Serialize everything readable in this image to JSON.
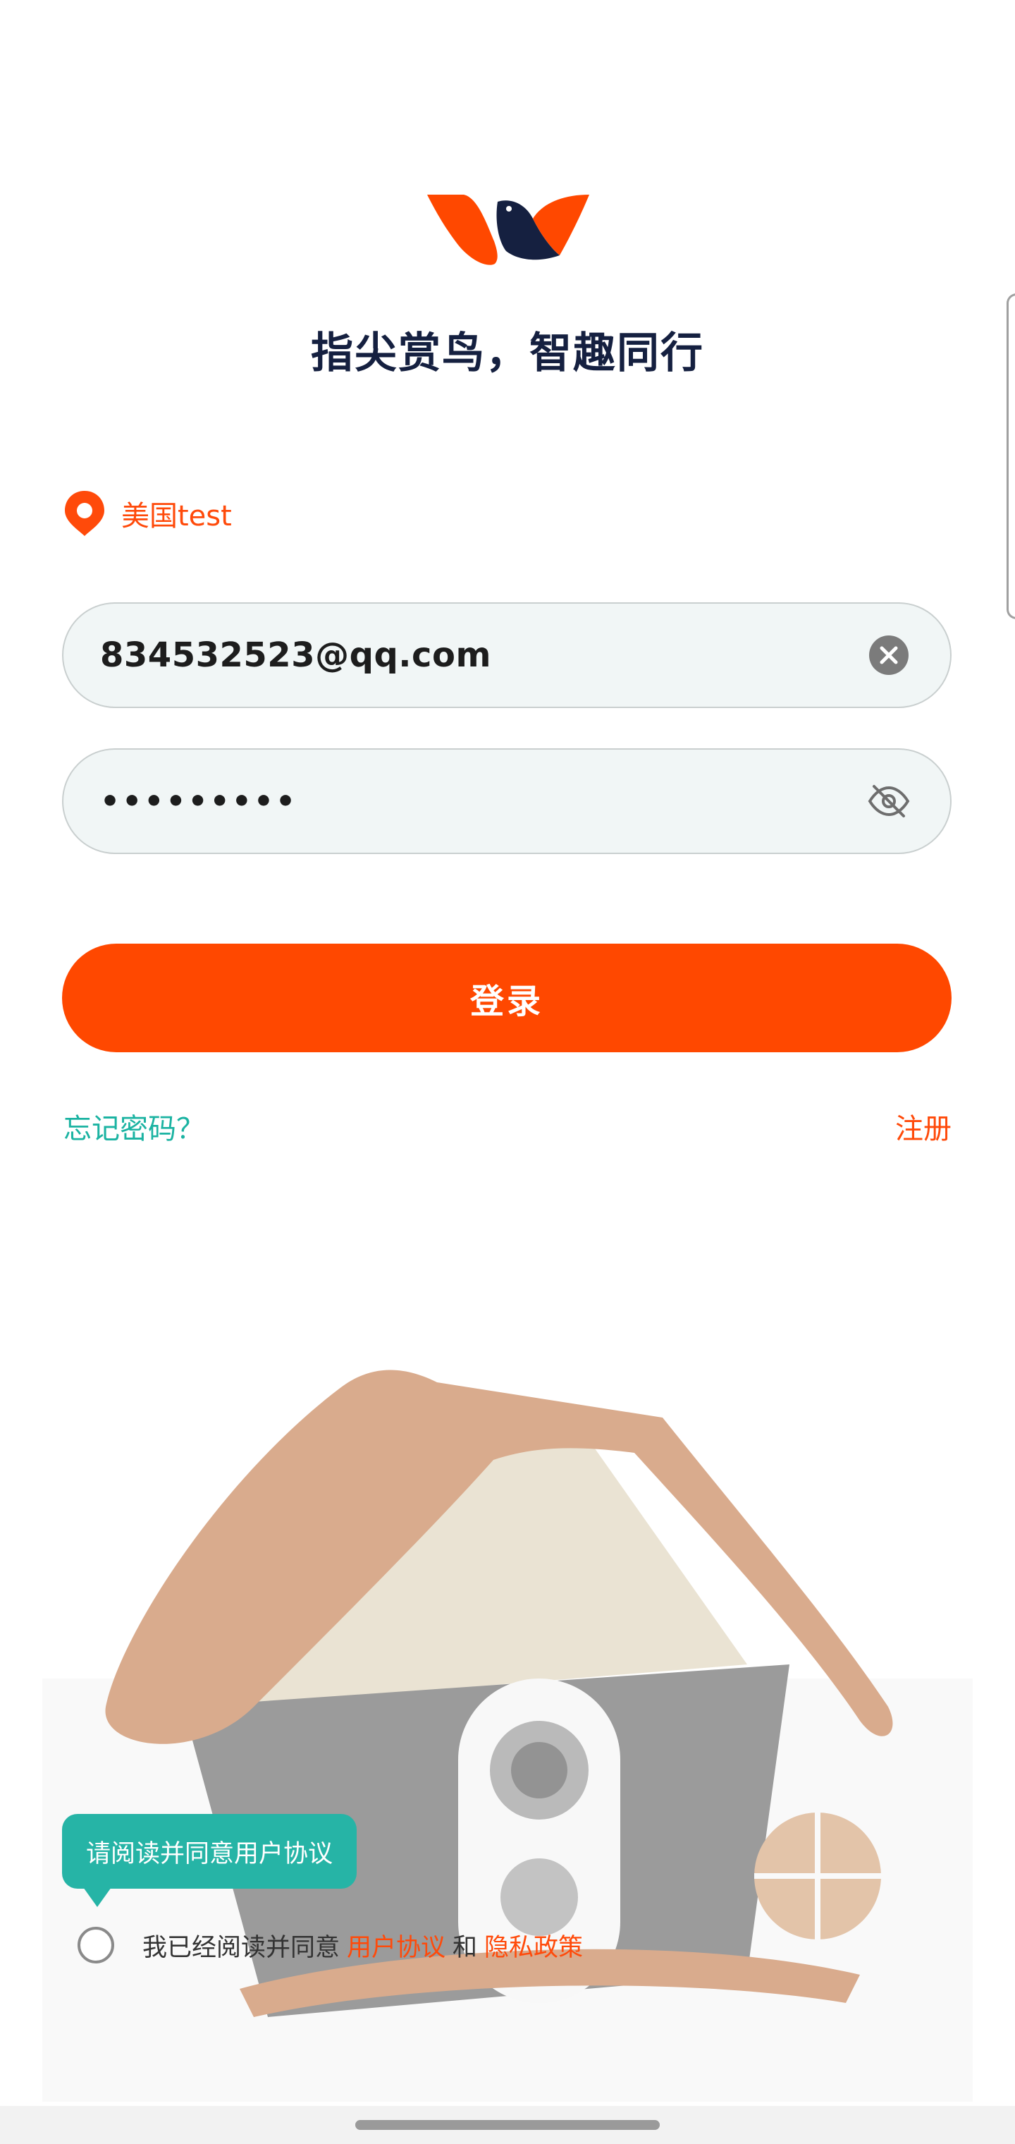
{
  "header": {
    "slogan": "指尖赏鸟，智趣同行"
  },
  "region": {
    "label": "美国test",
    "icon": "location-pin-icon"
  },
  "form": {
    "email_value": "834532523@qq.com",
    "password_value": "•••••••••",
    "clear_icon": "clear-circle-icon",
    "visibility_icon": "eye-off-icon"
  },
  "actions": {
    "login_label": "登录",
    "forgot_label": "忘记密码？",
    "register_label": "注册"
  },
  "agreement": {
    "tooltip": "请阅读并同意用户协议",
    "prefix": "我已经阅读并同意",
    "user_agreement": "用户协议",
    "and": "和",
    "privacy_policy": "隐私政策"
  },
  "colors": {
    "brand_orange": "#ff4800",
    "navy": "#152040",
    "teal": "#1bb3a2"
  }
}
